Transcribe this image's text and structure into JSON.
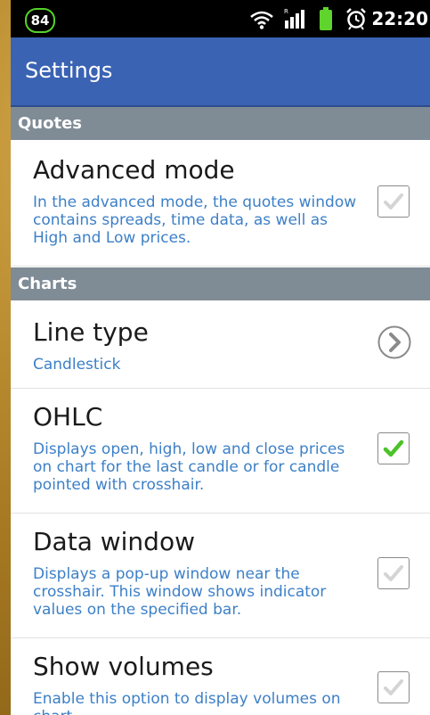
{
  "status_bar": {
    "battery_badge": "84",
    "time": "22:20"
  },
  "action_bar": {
    "title": "Settings"
  },
  "sections": {
    "quotes": "Quotes",
    "charts": "Charts"
  },
  "prefs": {
    "advanced_mode": {
      "title": "Advanced mode",
      "summary": "In the advanced mode, the quotes window contains spreads, time data, as well as High and Low prices.",
      "checked": false
    },
    "line_type": {
      "title": "Line type",
      "summary": "Candlestick"
    },
    "ohlc": {
      "title": "OHLC",
      "summary": "Displays open, high, low and close prices on chart for the last candle or for candle pointed with crosshair.",
      "checked": true
    },
    "data_window": {
      "title": "Data window",
      "summary": "Displays a pop-up window near the crosshair. This window shows indicator values on the specified bar.",
      "checked": false
    },
    "show_volumes": {
      "title": "Show volumes",
      "summary": "Enable this option to display volumes on chart",
      "checked": false
    }
  },
  "colors": {
    "action_bar": "#3b63b3",
    "section_header": "#7f8b95",
    "summary_text": "#3d80c7",
    "check_active": "#4cc229",
    "check_inactive": "#d4d4d4"
  },
  "icons": {
    "status": [
      "notification-badge",
      "wifi-icon",
      "signal-icon",
      "battery-icon",
      "alarm-icon"
    ],
    "line_type_action": "chevron-right-icon"
  }
}
